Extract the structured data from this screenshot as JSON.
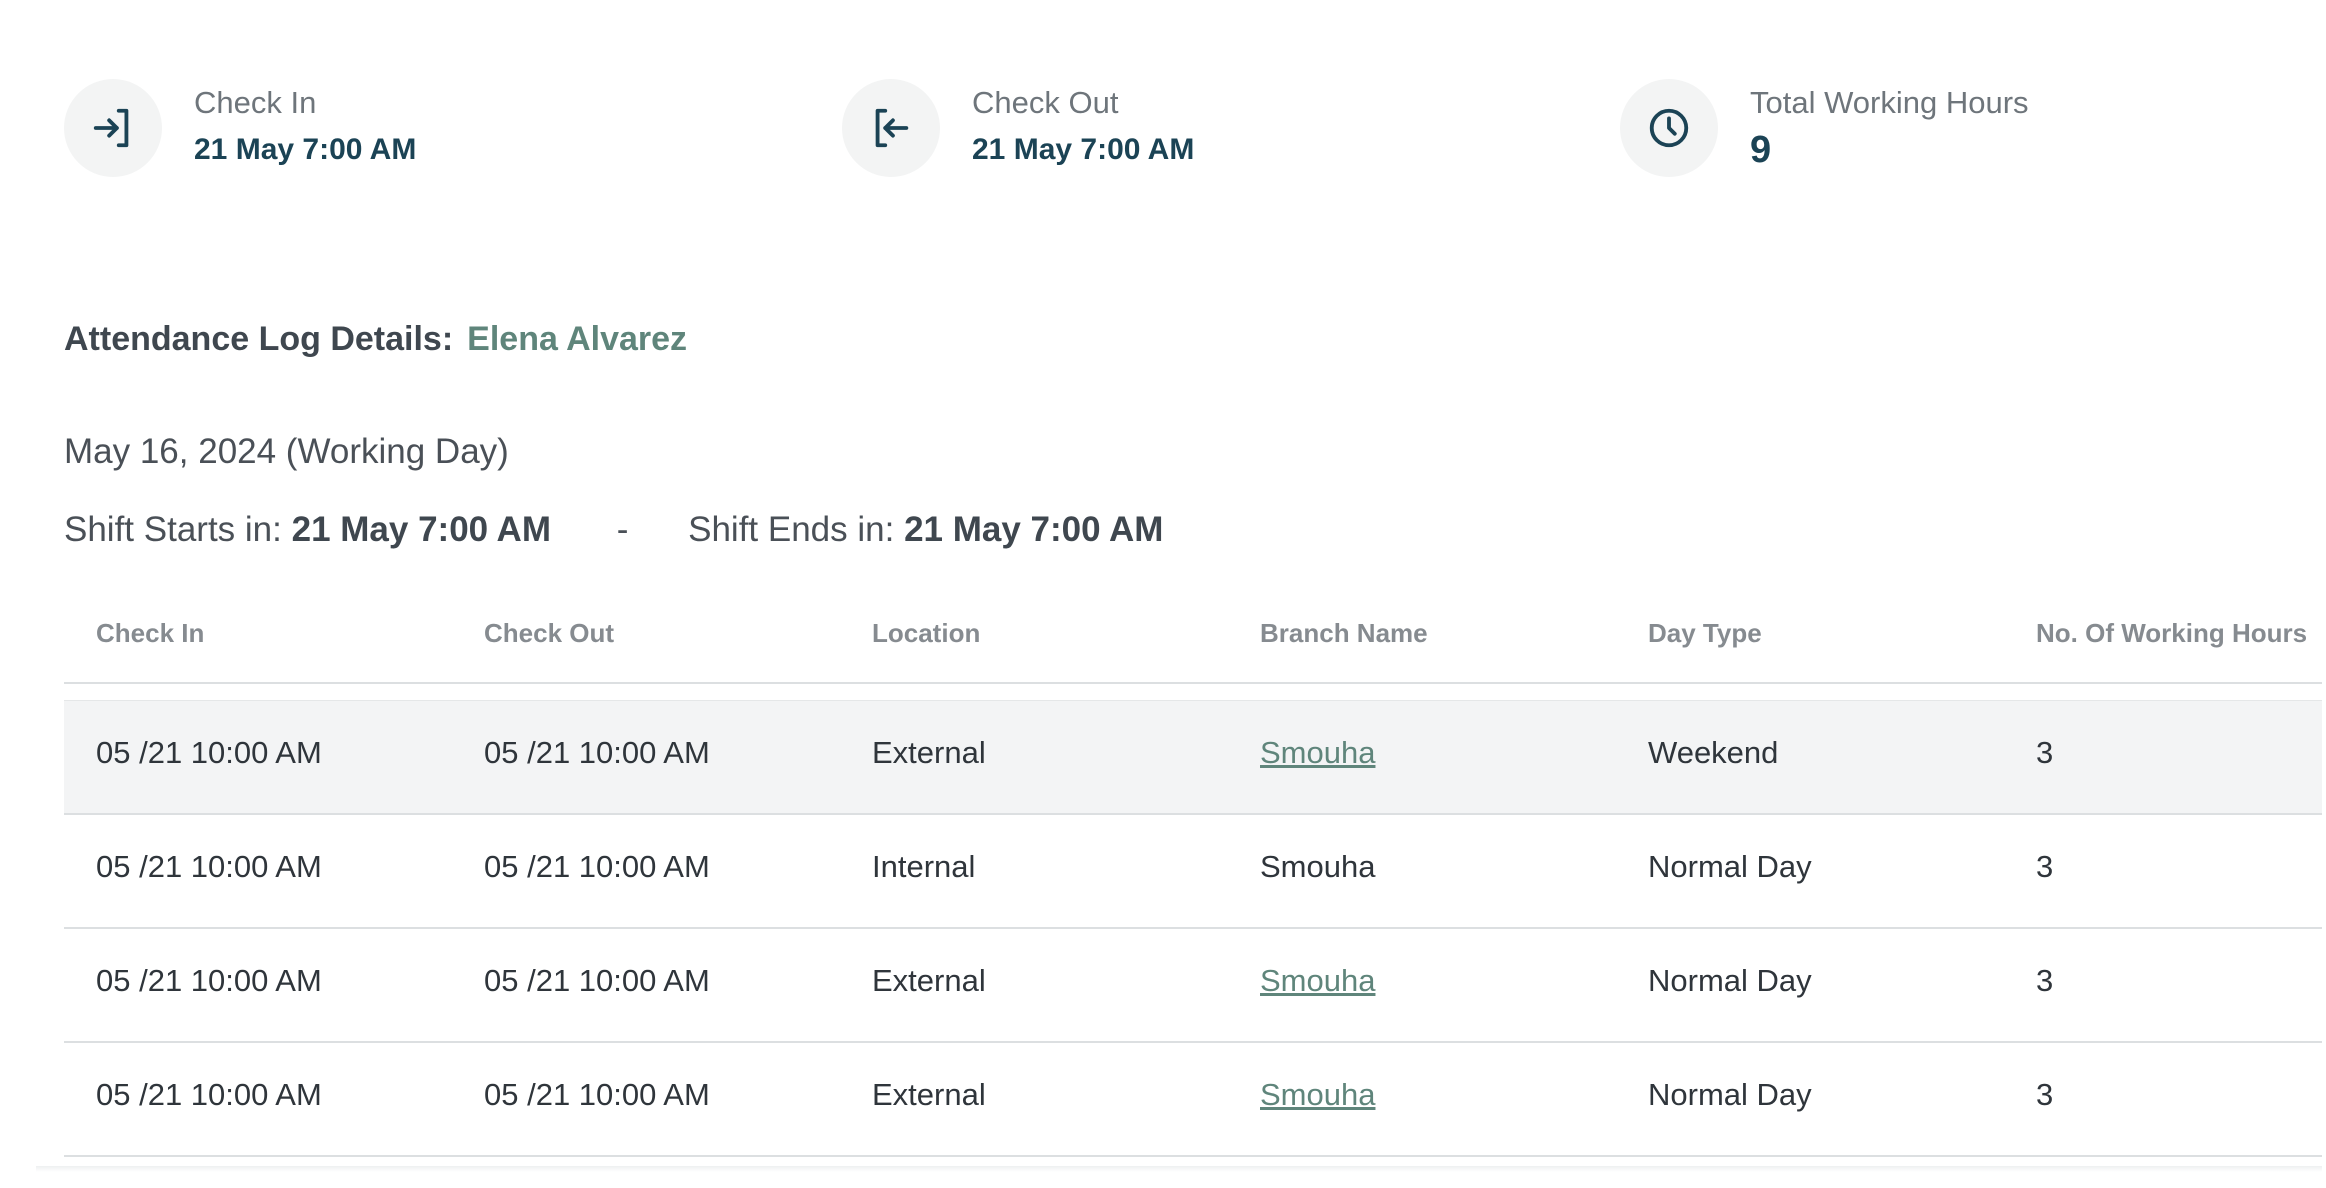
{
  "summary": {
    "check_in": {
      "label": "Check In",
      "value": "21 May 7:00 AM",
      "icon": "check-in-icon"
    },
    "check_out": {
      "label": "Check Out",
      "value": "21 May 7:00 AM",
      "icon": "check-out-icon"
    },
    "total_hours": {
      "label": "Total Working Hours",
      "value": "9",
      "icon": "clock-icon"
    }
  },
  "log": {
    "title": "Attendance Log Details:",
    "employee": "Elena Alvarez",
    "day_heading": "May 16, 2024 (Working Day)",
    "shift_start_label": "Shift Starts in:",
    "shift_start_value": "21 May 7:00 AM",
    "separator": "-",
    "shift_end_label": "Shift Ends in:",
    "shift_end_value": "21 May 7:00 AM"
  },
  "table": {
    "headers": [
      "Check In",
      "Check Out",
      "Location",
      "Branch Name",
      "Day Type",
      "No. Of  Working Hours"
    ],
    "rows": [
      {
        "check_in": "05 /21 10:00 AM",
        "check_out": "05 /21 10:00 AM",
        "location": "External",
        "branch": "Smouha",
        "day_type": "Weekend",
        "hours": "3"
      },
      {
        "check_in": "05 /21 10:00 AM",
        "check_out": "05 /21 10:00 AM",
        "location": "Internal",
        "branch": "Smouha",
        "day_type": "Normal Day",
        "hours": "3"
      },
      {
        "check_in": "05 /21 10:00 AM",
        "check_out": "05 /21 10:00 AM",
        "location": "External",
        "branch": "Smouha",
        "day_type": "Normal Day",
        "hours": "3"
      },
      {
        "check_in": "05 /21 10:00 AM",
        "check_out": "05 /21 10:00 AM",
        "location": "External",
        "branch": "Smouha",
        "day_type": "Normal Day",
        "hours": "3"
      }
    ]
  },
  "colors": {
    "accent": "#5f857b",
    "value_text": "#1b4355",
    "row_highlight": "#f3f4f5"
  }
}
